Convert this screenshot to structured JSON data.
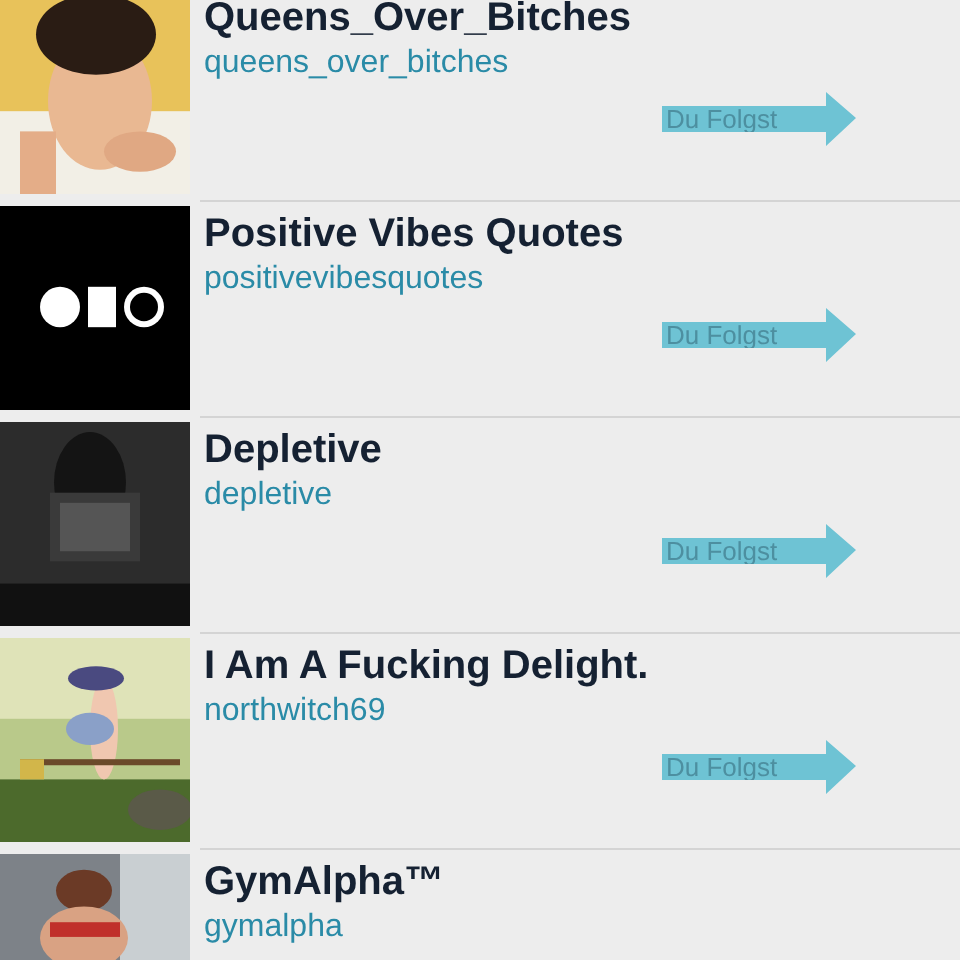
{
  "accounts": [
    {
      "name": "Queens_Over_Bitches",
      "handle": "queens_over_bitches",
      "button": "Du Folgst"
    },
    {
      "name": "Positive Vibes Quotes",
      "handle": "positivevibesquotes",
      "button": "Du Folgst"
    },
    {
      "name": "Depletive",
      "handle": "depletive",
      "button": "Du Folgst"
    },
    {
      "name": "I Am A Fucking Delight.",
      "handle": "northwitch69",
      "button": "Du Folgst"
    },
    {
      "name": "GymAlpha™",
      "handle": "gymalpha"
    }
  ]
}
